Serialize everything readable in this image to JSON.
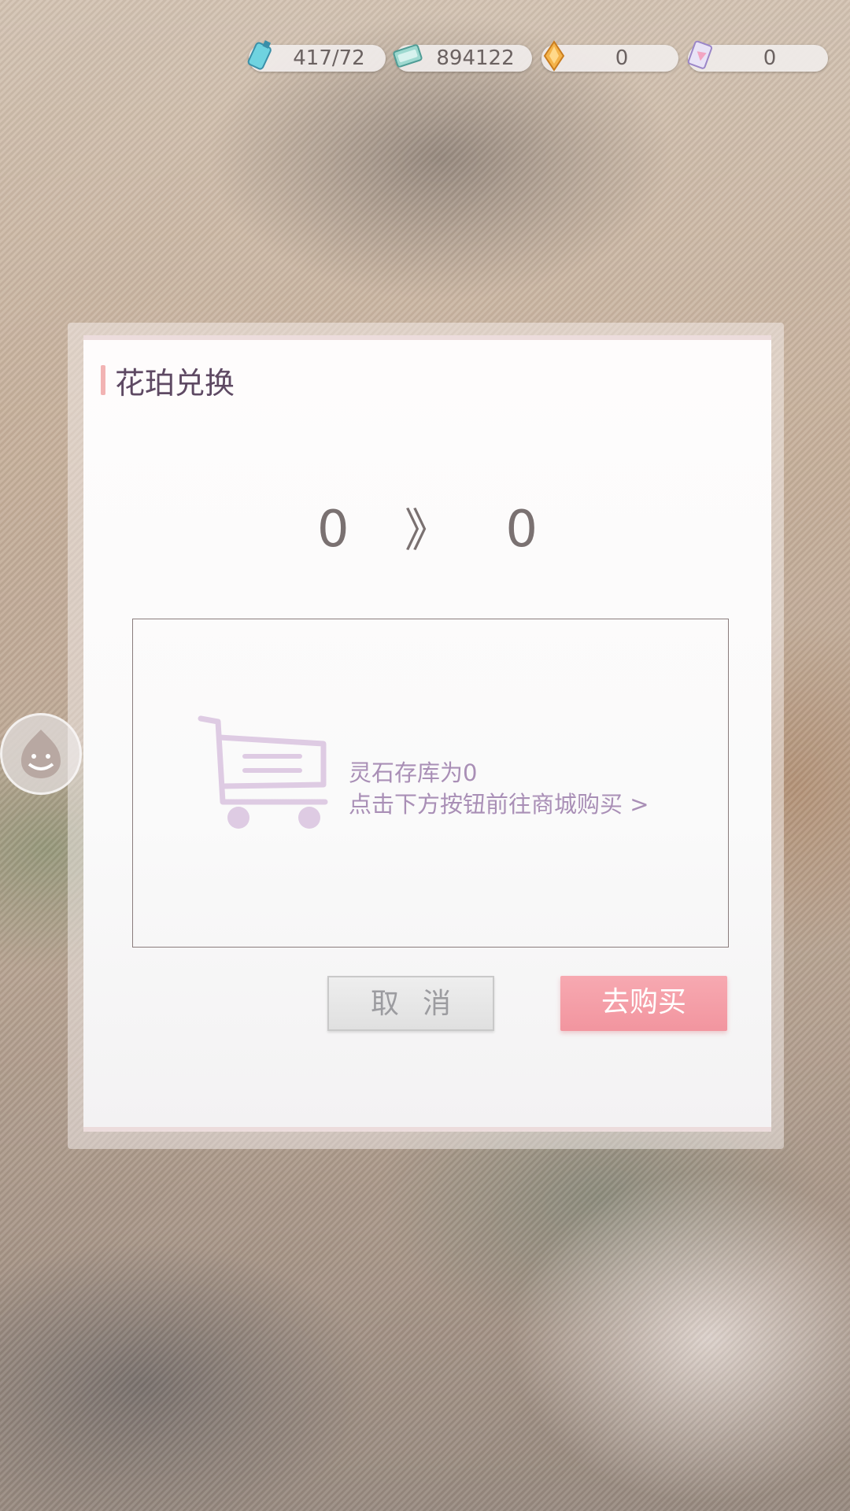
{
  "resources": [
    {
      "icon": "stamina-potion-icon",
      "value": "417/72"
    },
    {
      "icon": "money-bill-icon",
      "value": "894122"
    },
    {
      "icon": "amber-crystal-icon",
      "value": "0"
    },
    {
      "icon": "spirit-card-icon",
      "value": "0"
    }
  ],
  "dialog": {
    "title": "花珀兑换",
    "exchange_from": "0",
    "exchange_arrow": "》",
    "exchange_to": "0",
    "empty_message_line1": "灵石存库为0",
    "empty_message_line2": "点击下方按钮前往商城购买 >",
    "cancel_label": "取消",
    "buy_label": "去购买"
  },
  "colors": {
    "title": "#5e4963",
    "accent_pink": "#f2959f",
    "message_purple": "#a98fb6"
  }
}
